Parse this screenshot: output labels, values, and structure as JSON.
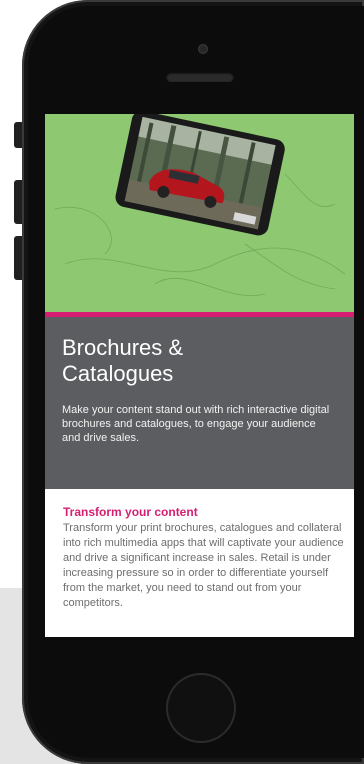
{
  "hero": {
    "image_name": "car-brochure-image",
    "tablet_badge": "FROM 36"
  },
  "panel": {
    "title_line1": "Brochures &",
    "title_line2": "Catalogues",
    "description": "Make your content stand out with rich interactive digital brochures and catalogues, to engage your audience and drive sales."
  },
  "content": {
    "heading": "Transform your content",
    "body": "Transform your print brochures, catalogues and collateral into rich multimedia apps that will captivate your audience and drive a significant increase in sales. Retail is under increasing pressure so in order to differentiate yourself from the market, you need to stand out from your competitors."
  },
  "colors": {
    "hero_green": "#8ec971",
    "accent_pink": "#d61f72",
    "panel_grey": "#5c5d60"
  }
}
